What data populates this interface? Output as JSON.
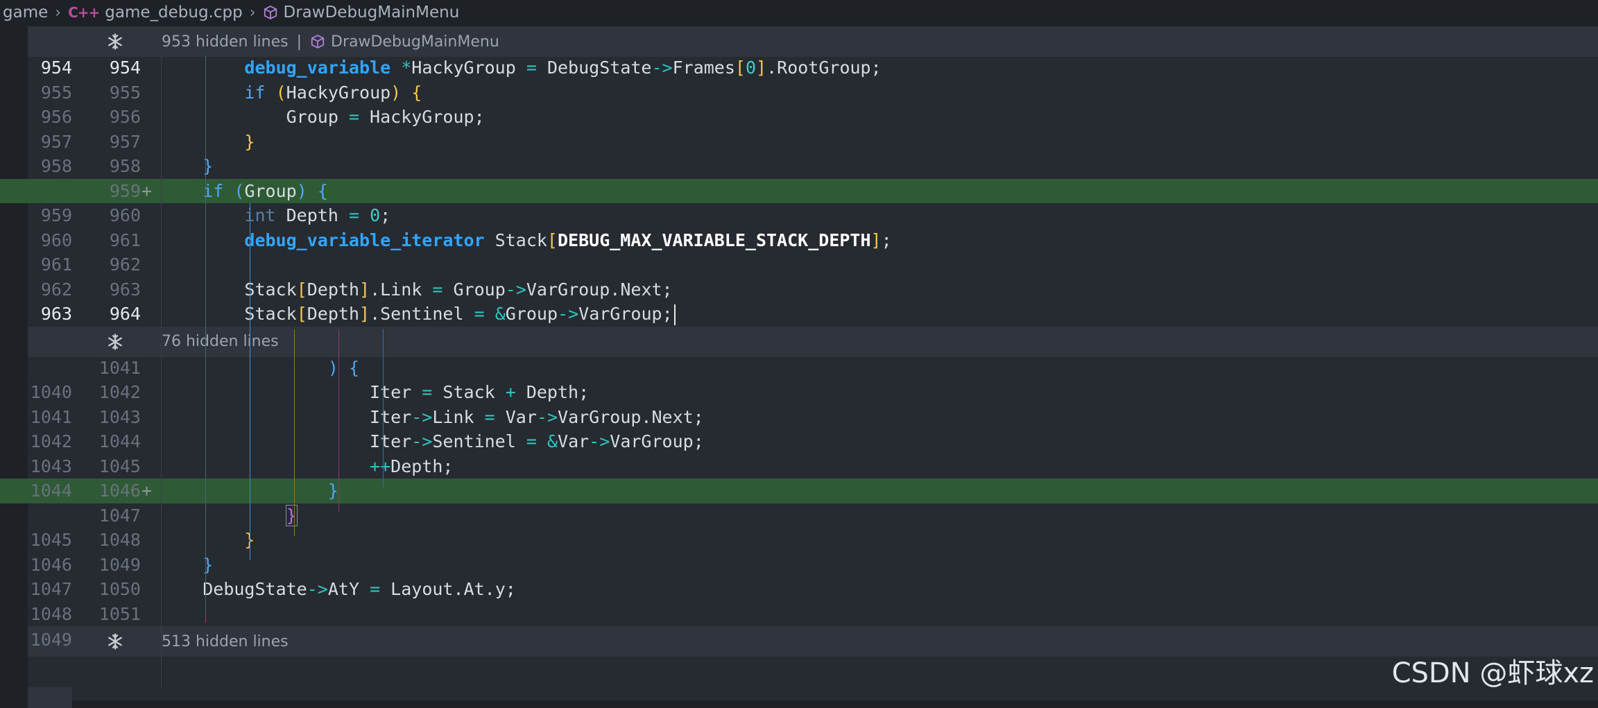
{
  "breadcrumb": {
    "items": [
      {
        "label": "game",
        "icon": ""
      },
      {
        "label": "game_debug.cpp",
        "icon": "cpp-file-icon"
      },
      {
        "label": "DrawDebugMainMenu",
        "icon": "symbol-method-icon"
      }
    ],
    "cpp_glyph": "C++"
  },
  "folds": [
    {
      "text": "953 hidden lines",
      "symbol": "DrawDebugMainMenu",
      "divider": "|"
    },
    {
      "text": "76 hidden lines"
    },
    {
      "text": "513 hidden lines"
    }
  ],
  "lines": [
    {
      "old": "954",
      "new": "954",
      "current": true,
      "tokens": [
        [
          "pad",
          "        "
        ],
        [
          "kb",
          "debug_variable"
        ],
        [
          "t",
          " "
        ],
        [
          "op",
          "*"
        ],
        [
          "t",
          "HackyGroup "
        ],
        [
          "op",
          "="
        ],
        [
          "t",
          " DebugState"
        ],
        [
          "op",
          "->"
        ],
        [
          "t",
          "Frames"
        ],
        [
          "b1",
          "["
        ],
        [
          "num",
          "0"
        ],
        [
          "b1",
          "]"
        ],
        [
          "t",
          ".RootGroup;"
        ]
      ]
    },
    {
      "old": "955",
      "new": "955",
      "tokens": [
        [
          "pad",
          "        "
        ],
        [
          "k",
          "if"
        ],
        [
          "t",
          " "
        ],
        [
          "b1",
          "("
        ],
        [
          "t",
          "HackyGroup"
        ],
        [
          "b1",
          ")"
        ],
        [
          "t",
          " "
        ],
        [
          "b1",
          "{"
        ]
      ]
    },
    {
      "old": "956",
      "new": "956",
      "tokens": [
        [
          "pad",
          "            "
        ],
        [
          "t",
          "Group "
        ],
        [
          "op",
          "="
        ],
        [
          "t",
          " HackyGroup;"
        ]
      ]
    },
    {
      "old": "957",
      "new": "957",
      "tokens": [
        [
          "pad",
          "        "
        ],
        [
          "b1",
          "}"
        ]
      ]
    },
    {
      "old": "958",
      "new": "958",
      "tokens": [
        [
          "pad",
          "    "
        ],
        [
          "b2",
          "}"
        ]
      ]
    },
    {
      "old": "",
      "new": "959",
      "added": true,
      "tokens": [
        [
          "pad",
          "    "
        ],
        [
          "k",
          "if"
        ],
        [
          "t",
          " "
        ],
        [
          "b2",
          "("
        ],
        [
          "t",
          "Group"
        ],
        [
          "b2",
          ")"
        ],
        [
          "t",
          " "
        ],
        [
          "b2",
          "{"
        ]
      ]
    },
    {
      "old": "959",
      "new": "960",
      "tokens": [
        [
          "pad",
          "        "
        ],
        [
          "kt",
          "int"
        ],
        [
          "t",
          " Depth "
        ],
        [
          "op",
          "="
        ],
        [
          "t",
          " "
        ],
        [
          "num",
          "0"
        ],
        [
          "t",
          ";"
        ]
      ]
    },
    {
      "old": "960",
      "new": "961",
      "tokens": [
        [
          "pad",
          "        "
        ],
        [
          "kb",
          "debug_variable_iterator"
        ],
        [
          "t",
          " Stack"
        ],
        [
          "b1",
          "["
        ],
        [
          "mac",
          "DEBUG_MAX_VARIABLE_STACK_DEPTH"
        ],
        [
          "b1",
          "]"
        ],
        [
          "t",
          ";"
        ]
      ]
    },
    {
      "old": "961",
      "new": "962",
      "tokens": []
    },
    {
      "old": "962",
      "new": "963",
      "tokens": [
        [
          "pad",
          "        "
        ],
        [
          "t",
          "Stack"
        ],
        [
          "b1",
          "["
        ],
        [
          "t",
          "Depth"
        ],
        [
          "b1",
          "]"
        ],
        [
          "t",
          ".Link "
        ],
        [
          "op",
          "="
        ],
        [
          "t",
          " Group"
        ],
        [
          "op",
          "->"
        ],
        [
          "t",
          "VarGroup.Next;"
        ]
      ]
    },
    {
      "old": "963",
      "new": "964",
      "current": true,
      "cursor": true,
      "tokens": [
        [
          "pad",
          "        "
        ],
        [
          "t",
          "Stack"
        ],
        [
          "b1",
          "["
        ],
        [
          "t",
          "Depth"
        ],
        [
          "b1",
          "]"
        ],
        [
          "t",
          ".Sentinel "
        ],
        [
          "op",
          "="
        ],
        [
          "t",
          " "
        ],
        [
          "op",
          "&"
        ],
        [
          "t",
          "Group"
        ],
        [
          "op",
          "->"
        ],
        [
          "t",
          "VarGroup;"
        ]
      ]
    },
    {
      "fold": 1
    },
    {
      "old": "",
      "new": "1041",
      "tokens": [
        [
          "pad",
          "                "
        ],
        [
          "b2",
          ")"
        ],
        [
          "t",
          " "
        ],
        [
          "b2",
          "{"
        ]
      ]
    },
    {
      "old": "1040",
      "new": "1042",
      "tokens": [
        [
          "pad",
          "                    "
        ],
        [
          "t",
          "Iter "
        ],
        [
          "op",
          "="
        ],
        [
          "t",
          " Stack "
        ],
        [
          "op",
          "+"
        ],
        [
          "t",
          " Depth;"
        ]
      ]
    },
    {
      "old": "1041",
      "new": "1043",
      "tokens": [
        [
          "pad",
          "                    "
        ],
        [
          "t",
          "Iter"
        ],
        [
          "op",
          "->"
        ],
        [
          "t",
          "Link "
        ],
        [
          "op",
          "="
        ],
        [
          "t",
          " Var"
        ],
        [
          "op",
          "->"
        ],
        [
          "t",
          "VarGroup.Next;"
        ]
      ]
    },
    {
      "old": "1042",
      "new": "1044",
      "tokens": [
        [
          "pad",
          "                    "
        ],
        [
          "t",
          "Iter"
        ],
        [
          "op",
          "->"
        ],
        [
          "t",
          "Sentinel "
        ],
        [
          "op",
          "="
        ],
        [
          "t",
          " "
        ],
        [
          "op",
          "&"
        ],
        [
          "t",
          "Var"
        ],
        [
          "op",
          "->"
        ],
        [
          "t",
          "VarGroup;"
        ]
      ]
    },
    {
      "old": "1043",
      "new": "1045",
      "tokens": [
        [
          "pad",
          "                    "
        ],
        [
          "op",
          "++"
        ],
        [
          "t",
          "Depth;"
        ]
      ]
    },
    {
      "old": "1044",
      "new": "1046",
      "added": true,
      "tokens": [
        [
          "pad",
          "                "
        ],
        [
          "b2",
          "}"
        ]
      ]
    },
    {
      "old": "",
      "new": "1047",
      "tokens": [
        [
          "pad",
          "            "
        ],
        [
          "b3m",
          "}"
        ]
      ]
    },
    {
      "old": "1045",
      "new": "1048",
      "tokens": [
        [
          "pad",
          "        "
        ],
        [
          "b1",
          "}"
        ]
      ]
    },
    {
      "old": "1046",
      "new": "1049",
      "tokens": [
        [
          "pad",
          "    "
        ],
        [
          "b2",
          "}"
        ]
      ]
    },
    {
      "old": "1047",
      "new": "1050",
      "tokens": [
        [
          "pad",
          "    "
        ],
        [
          "t",
          "DebugState"
        ],
        [
          "op",
          "->"
        ],
        [
          "t",
          "AtY "
        ],
        [
          "op",
          "="
        ],
        [
          "t",
          " Layout.At.y;"
        ]
      ]
    },
    {
      "old": "1048",
      "new": "1051",
      "tokens": []
    },
    {
      "fold": 2,
      "old": "1049"
    }
  ],
  "watermark": "CSDN @虾球xz",
  "colors": {
    "added_bg": "#2f5a36",
    "keyword": "#4fa8f2",
    "bracket_gold": "#f2c94c"
  }
}
